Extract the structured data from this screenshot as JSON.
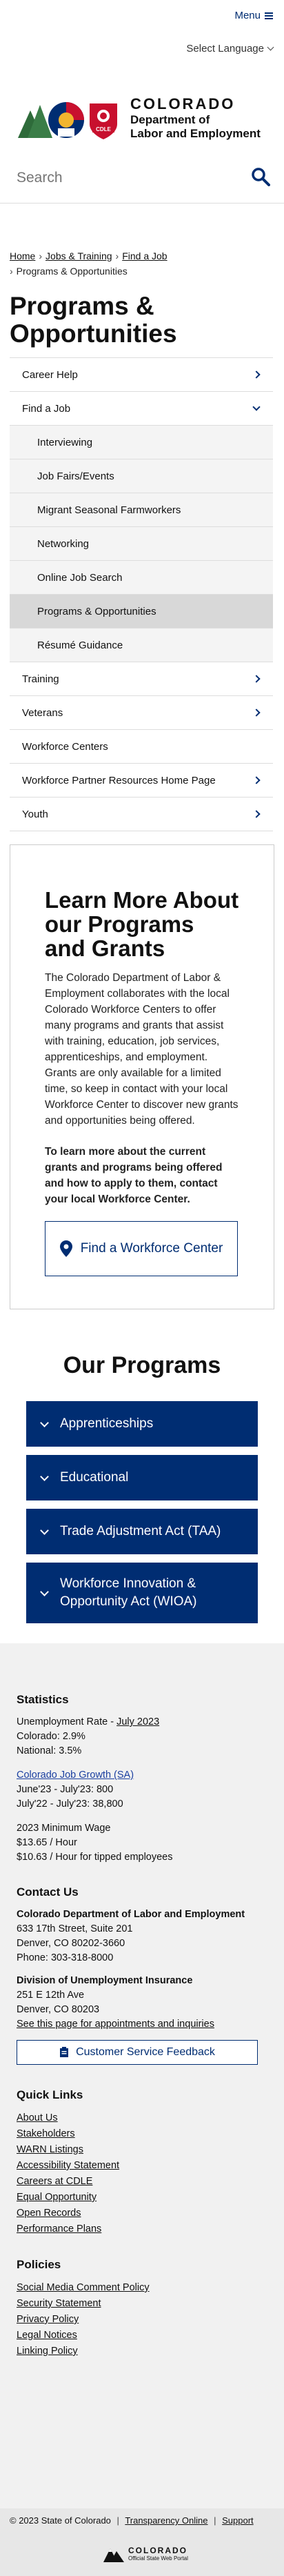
{
  "header": {
    "menu_label": "Menu",
    "language_label": "Select Language",
    "logo": {
      "state": "COLORADO",
      "dept_line1": "Department of",
      "dept_line2": "Labor and Employment",
      "badge": "CDLE"
    },
    "search_placeholder": "Search"
  },
  "breadcrumb": {
    "items": [
      "Home",
      "Jobs & Training",
      "Find a Job",
      "Programs & Opportunities"
    ]
  },
  "page_title": "Programs & Opportunities",
  "sidenav": {
    "items": [
      {
        "label": "Career Help",
        "icon": "chevron-right-icon"
      },
      {
        "label": "Find a Job",
        "icon": "chevron-down-icon"
      },
      {
        "label": "Interviewing"
      },
      {
        "label": "Job Fairs/Events"
      },
      {
        "label": "Migrant Seasonal Farmworkers"
      },
      {
        "label": "Networking"
      },
      {
        "label": "Online Job Search"
      },
      {
        "label": "Programs & Opportunities"
      },
      {
        "label": "Résumé Guidance"
      },
      {
        "label": "Training",
        "icon": "chevron-right-icon"
      },
      {
        "label": "Veterans",
        "icon": "chevron-right-icon"
      },
      {
        "label": "Workforce Centers"
      },
      {
        "label": "Workforce Partner Resources Home Page",
        "icon": "chevron-right-icon"
      },
      {
        "label": "Youth",
        "icon": "chevron-right-icon"
      }
    ]
  },
  "learn_more": {
    "heading": "Learn More About our Programs and Grants",
    "body": "The Colorado Department of Labor & Employment collaborates with the local Colorado Workforce Centers to offer many programs and grants that assist with training, education, job services, apprenticeships, and employment. Grants are only available for a limited time, so keep in contact with your local Workforce Center to discover new grants and opportunities being offered.",
    "bold": "To learn more about the current grants and programs being offered and how to apply to them, contact your local Workforce Center.",
    "button_label": "Find a Workforce Center"
  },
  "programs": {
    "title": "Our Programs",
    "items": [
      "Apprenticeships",
      "Educational",
      "Trade Adjustment Act (TAA)",
      "Workforce Innovation & Opportunity Act (WIOA)"
    ]
  },
  "footer": {
    "statistics": {
      "heading": "Statistics",
      "unemp_label": "Unemployment Rate - ",
      "unemp_link": "July 2023",
      "colorado": "Colorado: 2.9%",
      "national": "National: 3.5%",
      "growth_link": "Colorado Job Growth (SA)",
      "growth_1": "June'23 - July'23: 800",
      "growth_2": "July'22 - July'23: 38,800",
      "minwage": "2023 Minimum Wage",
      "wage_1": "$13.65 / Hour",
      "wage_2": "$10.63 / Hour for tipped employees"
    },
    "contact": {
      "heading": "Contact Us",
      "org": "Colorado Department of Labor and Employment",
      "addr1": "633 17th Street, Suite 201",
      "addr2": "Denver, CO  80202-3660",
      "phone": "Phone: 303-318-8000",
      "div": "Division of Unemployment Insurance",
      "div_addr1": "251 E 12th Ave",
      "div_addr2": "Denver, CO  80203",
      "appt_link": "See this page for appointments and inquiries",
      "feedback_label": "Customer Service Feedback"
    },
    "quick_links": {
      "heading": "Quick Links",
      "items": [
        "About Us",
        "Stakeholders",
        "WARN Listings",
        "Accessibility Statement",
        "Careers at CDLE",
        "Equal Opportunity",
        "Open Records",
        "Performance Plans"
      ]
    },
    "policies": {
      "heading": "Policies",
      "items": [
        "Social Media Comment Policy",
        "Security Statement",
        "Privacy Policy",
        "Legal Notices",
        "Linking Policy"
      ]
    },
    "copyright": "© 2023 State of Colorado",
    "transparency": "Transparency Online",
    "support": "Support",
    "portal_name": "COLORADO",
    "portal_sub": "Official State Web Portal"
  },
  "colors": {
    "navy": "#002d72",
    "red": "#c8102e",
    "gold": "#f2b52e"
  }
}
